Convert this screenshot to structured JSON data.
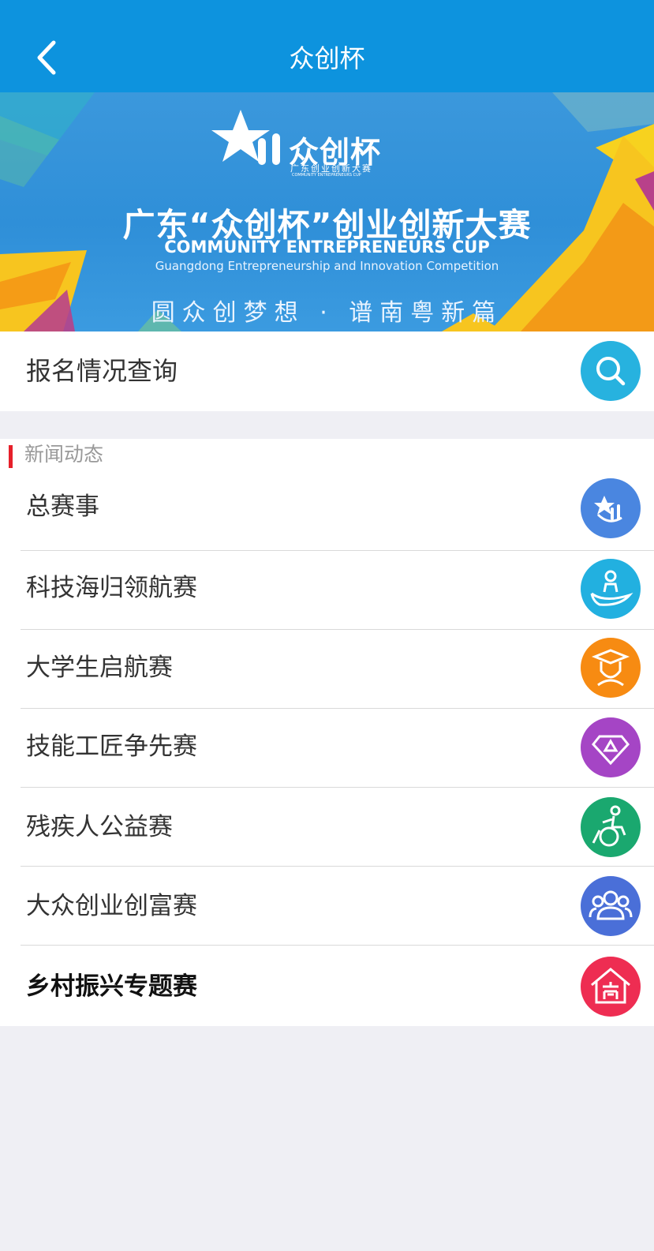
{
  "navbar": {
    "title": "众创杯",
    "back_icon": "chevron-left-icon"
  },
  "banner": {
    "logo_text": "众创杯",
    "logo_sub": "广东创业创新大赛",
    "logo_en": "COMMUNITY ENTREPRENEURS CUP",
    "title": "广东“众创杯”创业创新大赛",
    "en_title": "COMMUNITY ENTREPRENEURS CUP",
    "en_subtitle": "Guangdong Entrepreneurship and Innovation Competition",
    "slogan": "圆众创梦想 · 谱南粤新篇"
  },
  "query": {
    "label": "报名情况查询",
    "icon": "search-icon",
    "color": "#27b2df"
  },
  "news": {
    "title": "新闻动态",
    "accent": "#e6202a",
    "items": [
      {
        "label": "总赛事",
        "icon": "star-logo-icon",
        "color": "#4a86e0"
      },
      {
        "label": "科技海归领航赛",
        "icon": "person-wave-icon",
        "color": "#22b0e0"
      },
      {
        "label": "大学生启航赛",
        "icon": "graduate-icon",
        "color": "#f78b12"
      },
      {
        "label": "技能工匠争先赛",
        "icon": "diamond-icon",
        "color": "#a545c5"
      },
      {
        "label": "残疾人公益赛",
        "icon": "wheelchair-icon",
        "color": "#1aa86f"
      },
      {
        "label": "大众创业创富赛",
        "icon": "people-icon",
        "color": "#4a6fd8"
      },
      {
        "label": "乡村振兴专题赛",
        "icon": "shop-house-icon",
        "color": "#ee2d52"
      }
    ]
  }
}
